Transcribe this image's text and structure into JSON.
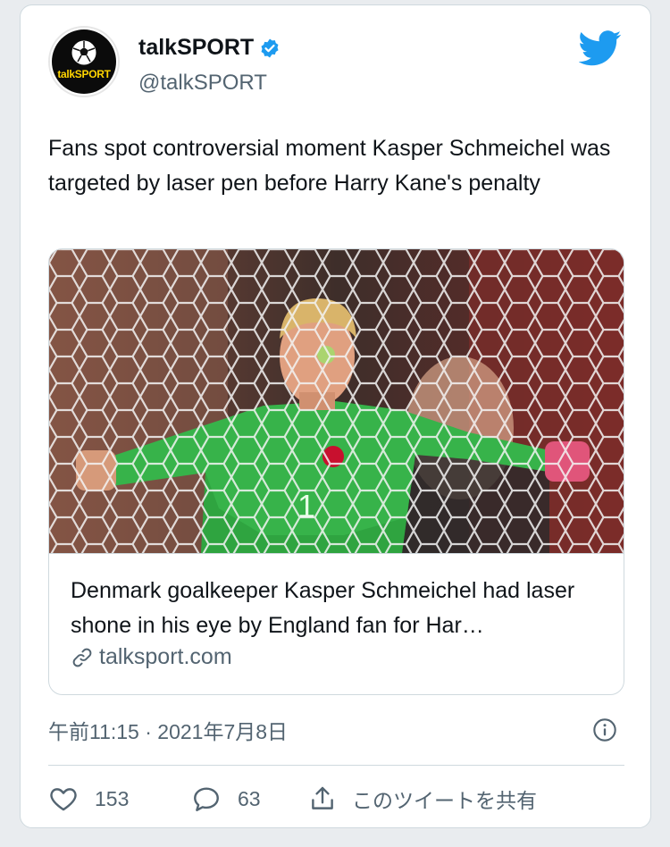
{
  "account": {
    "display_name": "talkSPORT",
    "handle": "@talkSPORT",
    "avatar_text": "talkSPORT",
    "verified": true
  },
  "tweet": {
    "text": "Fans spot controversial moment Kasper Schmeichel was targeted by laser pen before Harry Kane's penalty"
  },
  "link_card": {
    "title": "Denmark goalkeeper Kasper Schmeichel had laser shone in his eye by England fan for Har…",
    "domain": "talksport.com"
  },
  "meta": {
    "timestamp": "午前11:15 · 2021年7月8日"
  },
  "actions": {
    "like_count": "153",
    "reply_count": "63",
    "share_label": "このツイートを共有"
  },
  "colors": {
    "twitter_blue": "#1d9bf0",
    "secondary_text": "#536471",
    "border": "#cfd9de"
  }
}
